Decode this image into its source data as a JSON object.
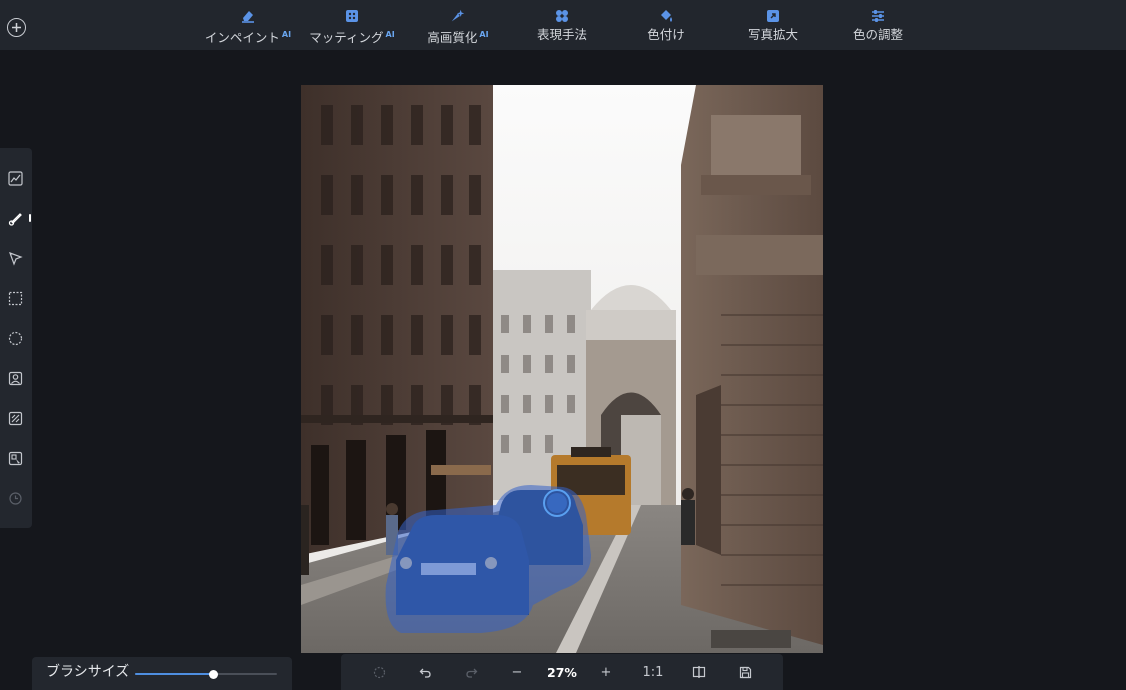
{
  "top_toolbar": {
    "add_icon": "plus-circle-icon",
    "tabs": [
      {
        "label": "インペイント",
        "ai_badge": "AI",
        "icon": "eraser-icon"
      },
      {
        "label": "マッティング",
        "ai_badge": "AI",
        "icon": "matting-icon"
      },
      {
        "label": "高画質化",
        "ai_badge": "AI",
        "icon": "sparkle-icon"
      },
      {
        "label": "表現手法",
        "ai_badge": "",
        "icon": "style-icon"
      },
      {
        "label": "色付け",
        "ai_badge": "",
        "icon": "paint-bucket-icon"
      },
      {
        "label": "写真拡大",
        "ai_badge": "",
        "icon": "enlarge-icon"
      },
      {
        "label": "色の調整",
        "ai_badge": "",
        "icon": "sliders-icon"
      }
    ]
  },
  "left_toolbar": {
    "items": [
      "chart-icon",
      "brush-icon",
      "pointer-icon",
      "rect-select-icon",
      "ellipse-select-icon",
      "portrait-icon",
      "pattern-icon",
      "object-select-icon",
      "history-icon"
    ],
    "active_item": "brush-icon"
  },
  "brush_panel": {
    "label": "ブラシサイズ",
    "value": 0.55
  },
  "bottom_bar": {
    "zoom_value": "27%",
    "zoom_in": "+",
    "zoom_out": "−",
    "actual_size": "1:1"
  },
  "colors": {
    "accent": "#4e8ee0",
    "mask": "#3563c8",
    "toolbar_bg": "#22262d",
    "canvas_bg": "#15171c"
  }
}
